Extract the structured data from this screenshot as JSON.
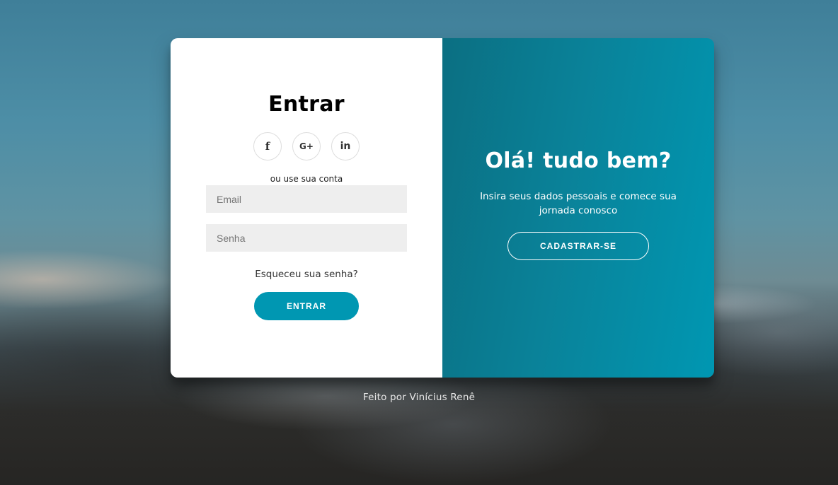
{
  "signin": {
    "title": "Entrar",
    "social": [
      {
        "icon": "facebook-icon",
        "glyph": "f"
      },
      {
        "icon": "google-plus-icon",
        "glyph": "G+"
      },
      {
        "icon": "linkedin-icon",
        "glyph": "in"
      }
    ],
    "alt_text": "ou use sua conta",
    "email_placeholder": "Email",
    "password_placeholder": "Senha",
    "forgot_label": "Esqueceu sua senha?",
    "submit_label": "Entrar"
  },
  "overlay": {
    "title": "Olá! tudo bem?",
    "text": "Insira seus dados pessoais e comece sua jornada conosco",
    "signup_label": "Cadastrar-se"
  },
  "footer": {
    "text": "Feito por Vinícius Renê"
  },
  "colors": {
    "accent": "#0097b2",
    "panel_bg": "#ffffff",
    "input_bg": "#eeeeee"
  }
}
